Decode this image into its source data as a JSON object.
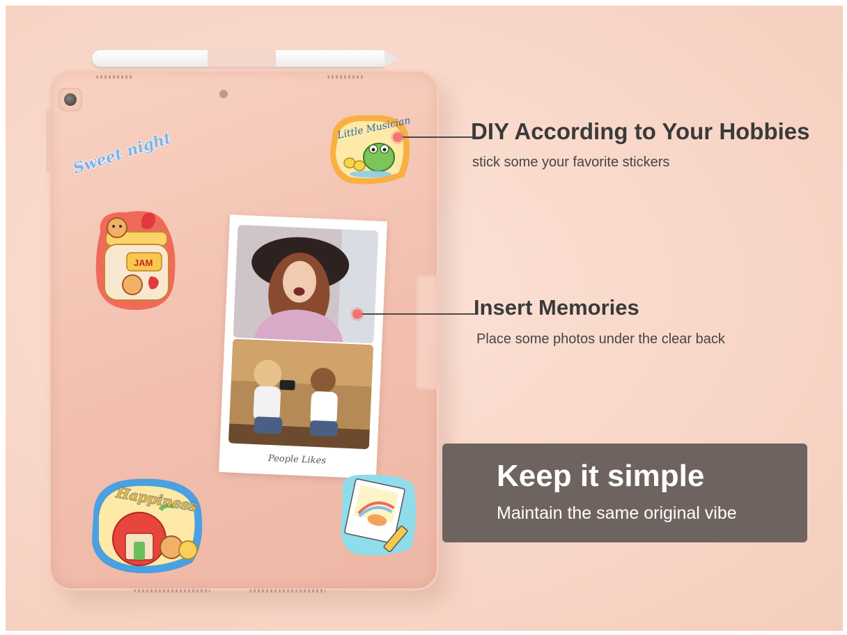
{
  "callouts": [
    {
      "title": "DIY According to Your Hobbies",
      "subtitle": "stick some your favorite stickers"
    },
    {
      "title": "Insert Memories",
      "subtitle": "Place some photos under  the clear back"
    }
  ],
  "banner": {
    "title": "Keep it simple",
    "subtitle": "Maintain the same original vibe"
  },
  "stickers": {
    "sweet_night": "Sweet night",
    "little_musician": "Little Musician",
    "jam": "JAM",
    "happiness": "Happiness"
  },
  "photo_card": {
    "signature": "People Likes"
  },
  "colors": {
    "background": "#f8d7c8",
    "tablet": "#f2bfae",
    "accent_dot": "#f37373",
    "banner_bg": "#6f6360",
    "text_dark": "#3a3a3a"
  }
}
